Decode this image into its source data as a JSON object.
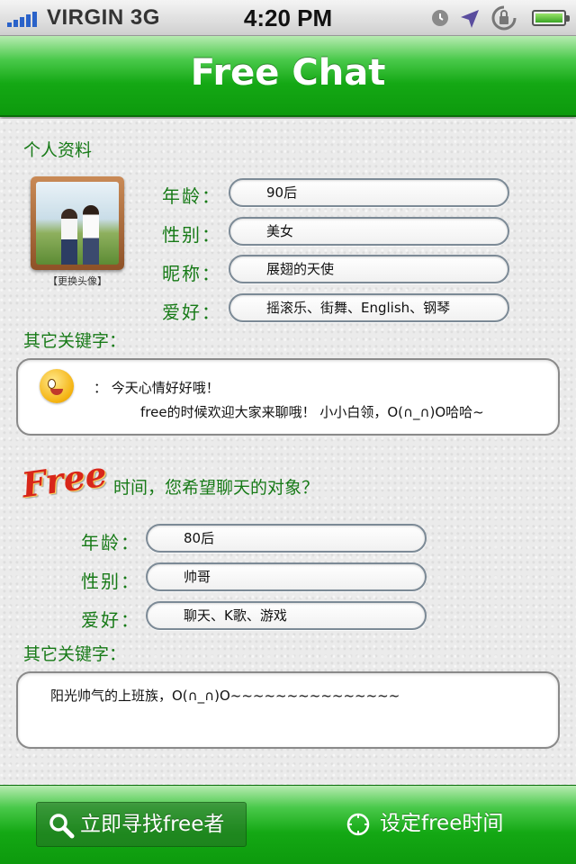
{
  "status_bar": {
    "carrier": "VIRGIN",
    "network": "3G",
    "time": "4:20 PM",
    "icons": [
      "signal-bars-icon",
      "alarm-icon",
      "location-arrow-icon",
      "rotation-lock-icon",
      "battery-icon"
    ]
  },
  "header": {
    "title": "Free Chat"
  },
  "profile": {
    "section_title": "个人资料",
    "avatar_caption": "【更换头像】",
    "fields": [
      {
        "label": "年龄：",
        "value": "90后"
      },
      {
        "label": "性别：",
        "value": "美女"
      },
      {
        "label": "昵称：",
        "value": "展翅的天使"
      },
      {
        "label": "爱好：",
        "value": "摇滚乐、街舞、English、钢琴"
      }
    ],
    "keywords_label": "其它关键字：",
    "keywords_line1": "：  今天心情好好哦！",
    "keywords_line2": "free的时候欢迎大家来聊哦！    小小白领，O(∩_∩)O哈哈~",
    "emoticon": "smiley-emoticon-icon"
  },
  "target": {
    "free_logo": "Free",
    "question": "时间，您希望聊天的对象？",
    "fields": [
      {
        "label": "年龄：",
        "value": "80后"
      },
      {
        "label": "性别：",
        "value": "帅哥"
      },
      {
        "label": "爱好：",
        "value": "聊天、K歌、游戏"
      }
    ],
    "keywords_label": "其它关键字：",
    "keywords_text": "阳光帅气的上班族，O(∩_∩)O~~~~~~~~~~~~~~~"
  },
  "bottom_bar": {
    "search_button": "立即寻找free者",
    "set_time_button": "设定free时间"
  },
  "colors": {
    "brand_green": "#14a814",
    "label_green": "#177a17",
    "free_logo_red": "#d8261a"
  }
}
